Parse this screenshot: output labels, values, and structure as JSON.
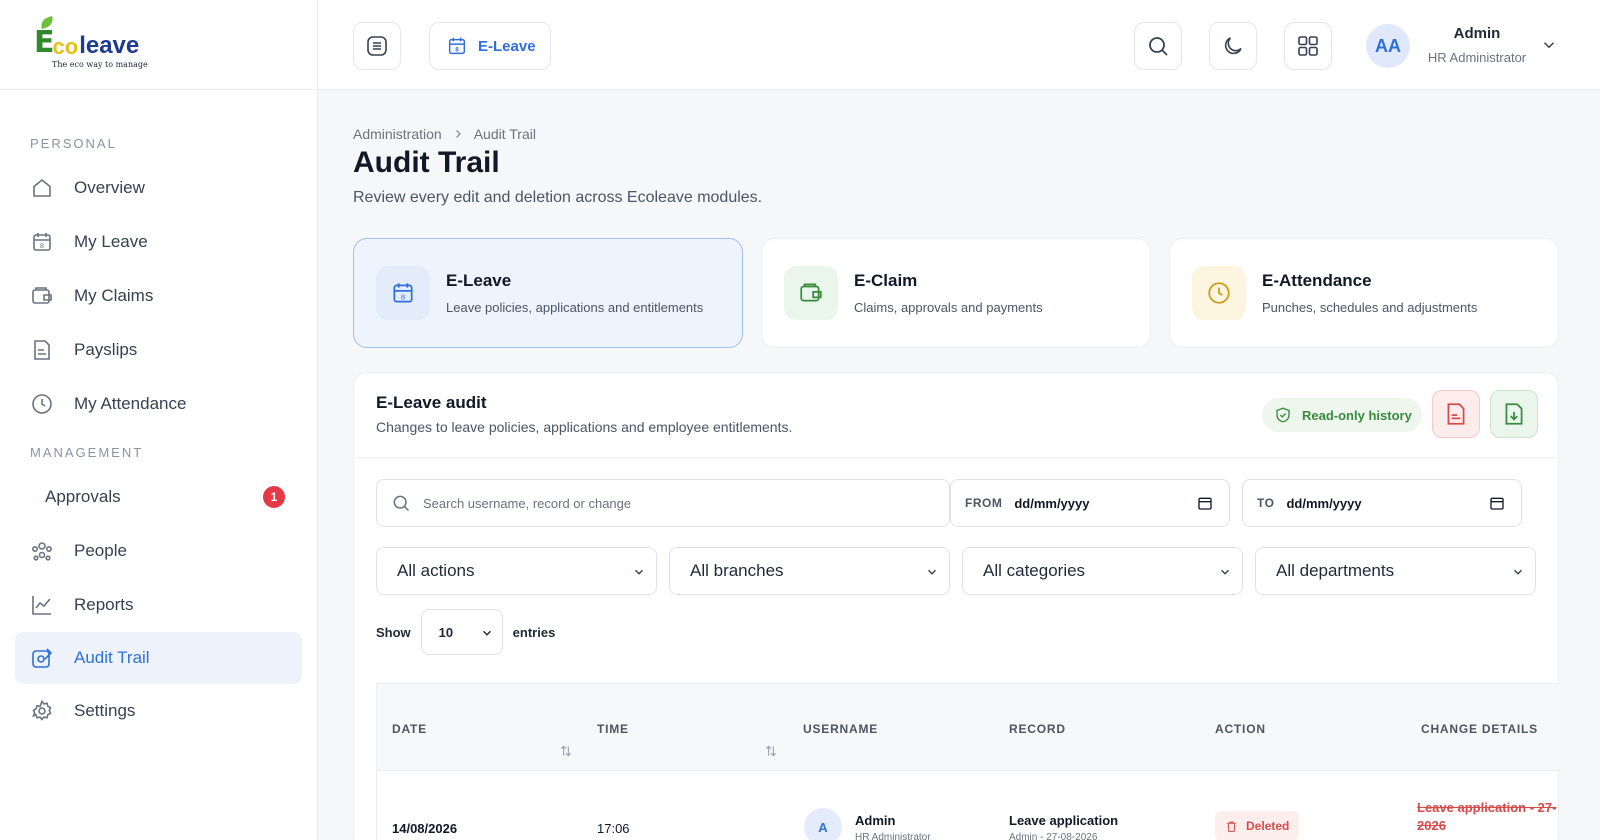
{
  "brand": {
    "logo_e": "E",
    "logo_co": "co",
    "logo_leave": "leave",
    "tagline": "The eco way to manage"
  },
  "sidebar": {
    "section_personal": "PERSONAL",
    "section_management": "MANAGEMENT",
    "personal": [
      {
        "label": "Overview",
        "icon": "home-icon"
      },
      {
        "label": "My Leave",
        "icon": "calendar-icon"
      },
      {
        "label": "My Claims",
        "icon": "wallet-icon"
      },
      {
        "label": "Payslips",
        "icon": "document-icon"
      },
      {
        "label": "My Attendance",
        "icon": "clock-icon"
      }
    ],
    "management": [
      {
        "label": "Approvals",
        "badge": "1"
      },
      {
        "label": "People",
        "icon": "people-icon"
      },
      {
        "label": "Reports",
        "icon": "chart-line-icon"
      },
      {
        "label": "Audit Trail",
        "icon": "audit-icon",
        "active": true
      },
      {
        "label": "Settings",
        "icon": "gear-icon"
      }
    ]
  },
  "topbar": {
    "module_chip": "E-Leave",
    "user": {
      "initials": "AA",
      "name": "Admin",
      "role": "HR Administrator"
    }
  },
  "page": {
    "breadcrumb": [
      "Administration",
      "Audit Trail"
    ],
    "title": "Audit Trail",
    "subtitle": "Review every edit and deletion across Ecoleave modules."
  },
  "modules": [
    {
      "title": "E-Leave",
      "subtitle": "Leave policies, applications and entitlements",
      "active": true
    },
    {
      "title": "E-Claim",
      "subtitle": "Claims, approvals and payments"
    },
    {
      "title": "E-Attendance",
      "subtitle": "Punches, schedules and adjustments"
    }
  ],
  "panel": {
    "title": "E-Leave audit",
    "subtitle": "Changes to leave policies, applications and employee entitlements.",
    "readonly_label": "Read-only history",
    "search_placeholder": "Search username, record or change",
    "from_label": "FROM",
    "from_value": "dd/mm/yyyy",
    "to_label": "TO",
    "to_value": "dd/mm/yyyy",
    "filters": [
      "All actions",
      "All branches",
      "All categories",
      "All departments"
    ],
    "show_label": "Show",
    "show_value": "10",
    "entries_label": "entries"
  },
  "table": {
    "columns": [
      "DATE",
      "TIME",
      "USERNAME",
      "RECORD",
      "ACTION",
      "CHANGE DETAILS"
    ],
    "rows": [
      {
        "date": "14/08/2026",
        "time": "17:06",
        "avatar": "A",
        "user": "Admin",
        "user_role": "HR Administrator",
        "record": "Leave application",
        "record_sub": "Admin - 27-08-2026",
        "action": "Deleted",
        "change": "Leave application - 27-2026"
      }
    ]
  },
  "colors": {
    "accent": "#2f6fdc",
    "danger": "#d84a4a",
    "success": "#3a8a3e"
  }
}
